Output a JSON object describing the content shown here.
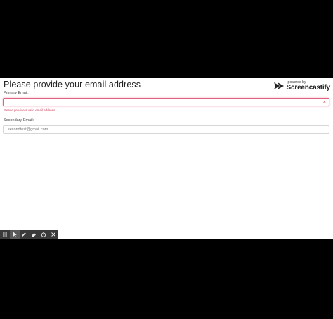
{
  "page": {
    "title": "Please provide your email address"
  },
  "logo": {
    "powered_by": "powered by",
    "name": "Screencastify",
    "icon": "screencastify-logo-icon"
  },
  "form": {
    "primary": {
      "label": "Primary Email:",
      "value": "",
      "error": "Please provide a valid email address",
      "clear_icon": "×"
    },
    "secondary": {
      "label": "Secondary Email:",
      "value": "",
      "placeholder": "secondtest@gmail.com"
    }
  },
  "toolbar": {
    "items": [
      {
        "icon": "pause-icon"
      },
      {
        "icon": "cursor-icon",
        "active": true
      },
      {
        "icon": "pen-icon"
      },
      {
        "icon": "eraser-icon"
      },
      {
        "icon": "timer-icon"
      },
      {
        "icon": "close-icon"
      }
    ]
  },
  "colors": {
    "error": "#d2445f",
    "error_border": "#e0637f",
    "toolbar_bg": "#3a3a3a"
  }
}
